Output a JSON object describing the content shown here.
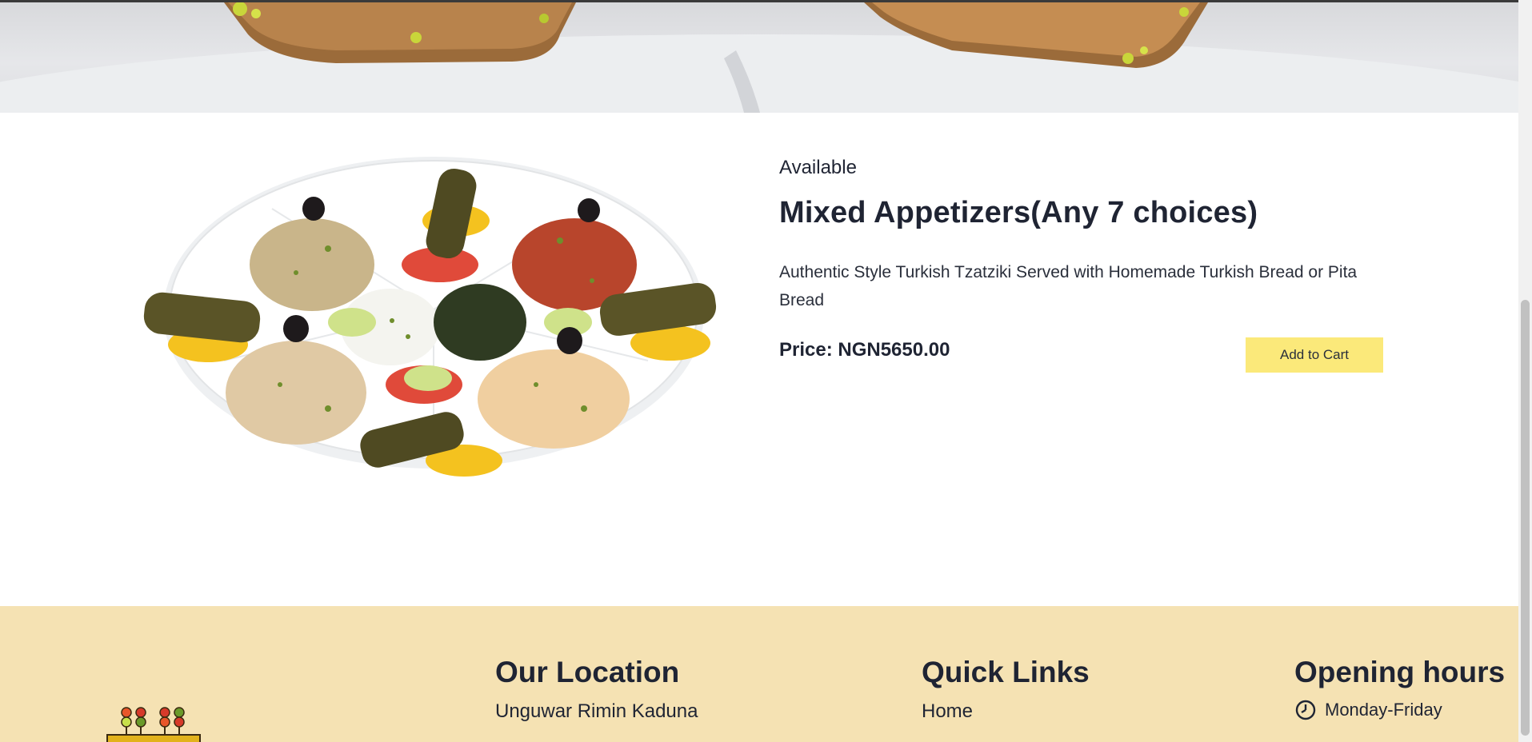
{
  "product": {
    "availability": "Available",
    "title": "Mixed Appetizers(Any 7 choices)",
    "description": "Authentic Style Turkish Tzatziki Served with Homemade Turkish Bread or Pita Bread",
    "price": "Price: NGN5650.00",
    "add_to_cart_label": "Add to Cart"
  },
  "footer": {
    "location": {
      "heading": "Our Location",
      "address": "Unguwar Rimin Kaduna"
    },
    "quick_links": {
      "heading": "Quick Links",
      "items": [
        "Home"
      ]
    },
    "opening_hours": {
      "heading": "Opening hours",
      "days": "Monday-Friday"
    }
  },
  "icons": {
    "clock": "clock-icon",
    "logo": "kebab-skewers-logo"
  },
  "colors": {
    "accent_button": "#fbe97a",
    "footer_bg": "#f5e2b3",
    "text": "#1f2433"
  }
}
